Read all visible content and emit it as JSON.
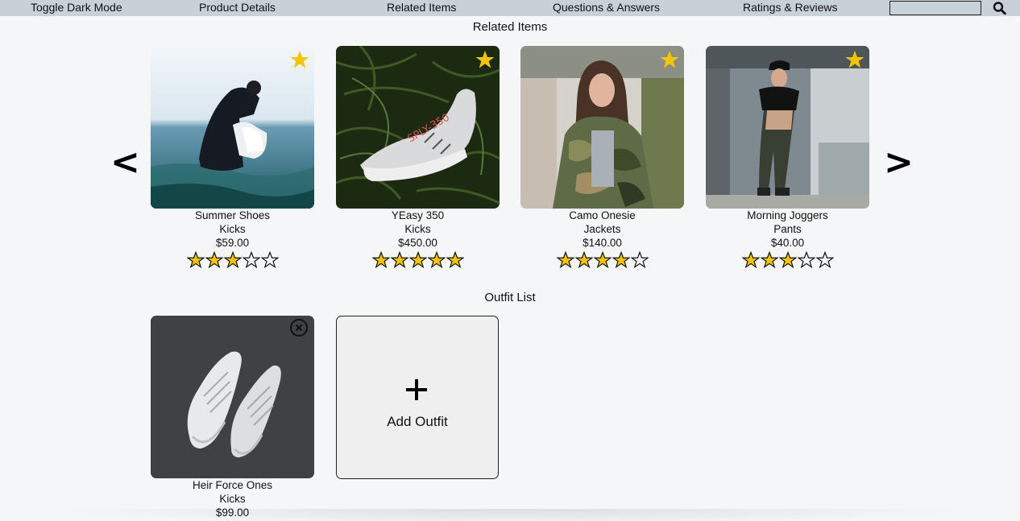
{
  "nav": {
    "dark_mode": "Toggle Dark Mode",
    "product_details": "Product Details",
    "related_items": "Related Items",
    "qa": "Questions & Answers",
    "ratings": "Ratings & Reviews",
    "search_value": ""
  },
  "related": {
    "title": "Related Items",
    "prev": "<",
    "next": ">",
    "items": [
      {
        "name": "Summer Shoes",
        "category": "Kicks",
        "price": "$59.00",
        "rating": 3
      },
      {
        "name": "YEasy 350",
        "category": "Kicks",
        "price": "$450.00",
        "rating": 5
      },
      {
        "name": "Camo Onesie",
        "category": "Jackets",
        "price": "$140.00",
        "rating": 4
      },
      {
        "name": "Morning Joggers",
        "category": "Pants",
        "price": "$40.00",
        "rating": 3
      }
    ]
  },
  "outfit": {
    "title": "Outfit List",
    "items": [
      {
        "name": "Heir Force Ones",
        "category": "Kicks",
        "price": "$99.00"
      }
    ],
    "add_label": "Add Outfit"
  },
  "colors": {
    "nav_bg": "#c8d1d8",
    "page_bg": "#f4f6f8",
    "star_gold": "#f5c400"
  },
  "icons": [
    "search-icon",
    "star-icon",
    "close-circle-icon",
    "plus-icon"
  ]
}
